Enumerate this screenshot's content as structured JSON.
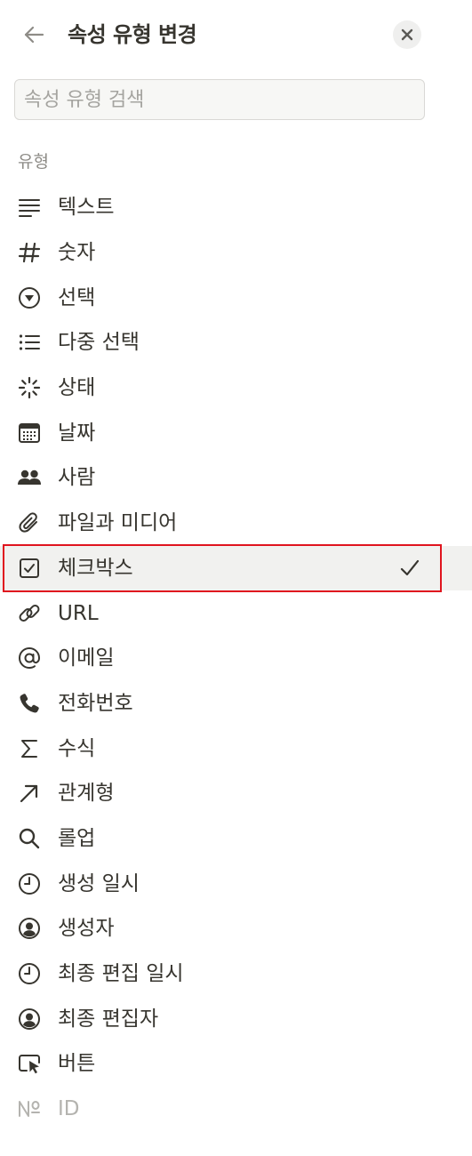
{
  "header": {
    "title": "속성 유형 변경",
    "back_icon": "arrow-left-icon",
    "close_icon": "close-icon"
  },
  "search": {
    "placeholder": "속성 유형 검색",
    "value": ""
  },
  "section": {
    "label": "유형"
  },
  "types": [
    {
      "label": "텍스트",
      "icon": "text-lines-icon"
    },
    {
      "label": "숫자",
      "icon": "hash-icon"
    },
    {
      "label": "선택",
      "icon": "select-circle-icon"
    },
    {
      "label": "다중 선택",
      "icon": "bullet-list-icon"
    },
    {
      "label": "상태",
      "icon": "status-spinner-icon"
    },
    {
      "label": "날짜",
      "icon": "calendar-icon"
    },
    {
      "label": "사람",
      "icon": "people-icon"
    },
    {
      "label": "파일과 미디어",
      "icon": "paperclip-icon"
    },
    {
      "label": "체크박스",
      "icon": "checkbox-icon",
      "selected": true
    },
    {
      "label": "URL",
      "icon": "link-icon"
    },
    {
      "label": "이메일",
      "icon": "at-sign-icon"
    },
    {
      "label": "전화번호",
      "icon": "phone-icon"
    },
    {
      "label": "수식",
      "icon": "sigma-icon"
    },
    {
      "label": "관계형",
      "icon": "arrow-up-right-icon"
    },
    {
      "label": "롤업",
      "icon": "magnifier-icon"
    },
    {
      "label": "생성 일시",
      "icon": "clock-icon"
    },
    {
      "label": "생성자",
      "icon": "user-circle-icon"
    },
    {
      "label": "최종 편집 일시",
      "icon": "clock-icon"
    },
    {
      "label": "최종 편집자",
      "icon": "user-circle-icon"
    },
    {
      "label": "버튼",
      "icon": "button-cursor-icon"
    },
    {
      "label": "ID",
      "icon": "numero-icon",
      "disabled": true
    }
  ],
  "selected_check_icon": "checkmark-icon",
  "colors": {
    "text": "#37352f",
    "icon": "#37352f",
    "muted": "#8e8c87",
    "disabled": "#b4b3af",
    "selected_bg": "#f1f1ef",
    "highlight_border": "#e0141e"
  }
}
